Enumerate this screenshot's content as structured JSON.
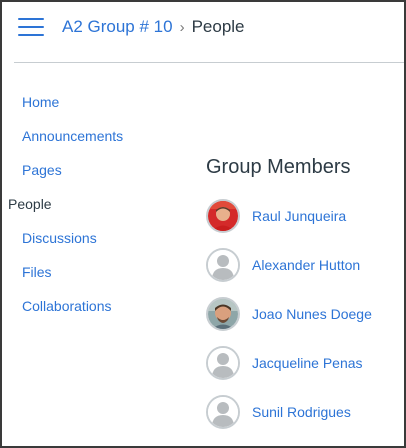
{
  "header": {
    "menu_icon": "hamburger-menu-icon",
    "breadcrumb": {
      "group": "A2 Group # 10",
      "separator": "›",
      "current": "People"
    }
  },
  "sidebar": {
    "items": [
      {
        "label": "Home"
      },
      {
        "label": "Announcements"
      },
      {
        "label": "Pages"
      },
      {
        "label": "People",
        "active": true
      },
      {
        "label": "Discussions"
      },
      {
        "label": "Files"
      },
      {
        "label": "Collaborations"
      }
    ]
  },
  "main": {
    "title": "Group Members",
    "members": [
      {
        "name": "Raul Junqueira",
        "avatar": "photo"
      },
      {
        "name": "Alexander Hutton",
        "avatar": "default-user-icon"
      },
      {
        "name": "Joao Nunes Doege",
        "avatar": "photo"
      },
      {
        "name": "Jacqueline Penas",
        "avatar": "default-user-icon"
      },
      {
        "name": "Sunil Rodrigues",
        "avatar": "default-user-icon"
      }
    ]
  },
  "colors": {
    "link": "#2d74d6",
    "text": "#2d3b45",
    "divider": "#c7cdd1"
  }
}
